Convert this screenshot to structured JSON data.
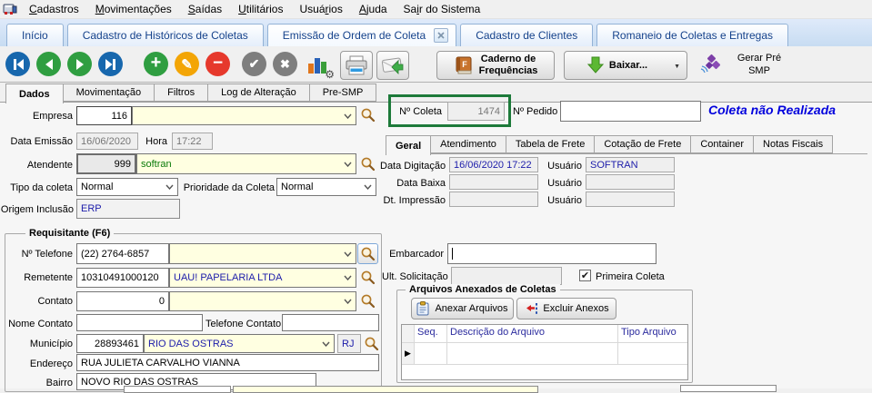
{
  "menubar": {
    "items": [
      {
        "pre": "",
        "key": "C",
        "post": "adastros"
      },
      {
        "pre": "",
        "key": "M",
        "post": "ovimentações"
      },
      {
        "pre": "",
        "key": "S",
        "post": "aídas"
      },
      {
        "pre": "",
        "key": "U",
        "post": "tilitários"
      },
      {
        "pre": "Usuá",
        "key": "r",
        "post": "ios"
      },
      {
        "pre": "",
        "key": "A",
        "post": "juda"
      },
      {
        "pre": "Sa",
        "key": "i",
        "post": "r do Sistema"
      }
    ]
  },
  "tabstrip": {
    "tabs": [
      "Início",
      "Cadastro de Históricos de Coletas",
      "Emissão de Ordem de Coleta",
      "Cadastro de Clientes",
      "Romaneio de Coletas e Entregas"
    ]
  },
  "toolbar": {
    "caderno": {
      "line1": "Caderno de",
      "line2": "Frequências"
    },
    "baixar": {
      "label": "Baixar..."
    },
    "gerar": {
      "line1": "Gerar Pré",
      "line2": "SMP"
    }
  },
  "subtabs": {
    "tabs": [
      "Dados",
      "Movimentação",
      "Filtros",
      "Log de Alteração",
      "Pre-SMP"
    ]
  },
  "header": {
    "coleta_label": "Nº Coleta",
    "coleta_value": "1474",
    "pedido_label": "Nº Pedido",
    "pedido_value": "",
    "status": "Coleta não Realizada"
  },
  "form": {
    "empresa_label": "Empresa",
    "empresa_code": "116",
    "empresa_name": "",
    "data_emissao_label": "Data Emissão",
    "data_emissao": "16/06/2020",
    "hora_label": "Hora",
    "hora": "17:22",
    "atendente_label": "Atendente",
    "atendente_code": "999",
    "atendente_name": "softran",
    "tipo_label": "Tipo da coleta",
    "tipo_value": "Normal",
    "prioridade_label": "Prioridade da Coleta",
    "prioridade_value": "Normal",
    "origem_label": "Origem Inclusão",
    "origem_value": "ERP"
  },
  "geral": {
    "tabs": [
      "Geral",
      "Atendimento",
      "Tabela de Frete",
      "Cotação de Frete",
      "Container",
      "Notas Fiscais"
    ],
    "digitacao_label": "Data Digitação",
    "digitacao_value": "16/06/2020 17:22",
    "usuario_label": "Usuário",
    "usuario1": "SOFTRAN",
    "baixa_label": "Data Baixa",
    "baixa_value": "",
    "usuario2": "",
    "impressao_label": "Dt. Impressão",
    "impressao_value": "",
    "usuario3": ""
  },
  "requisitante": {
    "title": "Requisitante (F6)",
    "telefone_label": "Nº Telefone",
    "telefone": "(22) 2764-6857",
    "telefone_combo": "",
    "remetente_label": "Remetente",
    "remetente_code": "10310491000120",
    "remetente_name": "UAU! PAPELARIA LTDA",
    "contato_label": "Contato",
    "contato_code": "0",
    "contato_name": "",
    "nome_contato_label": "Nome Contato",
    "nome_contato": "",
    "telefone_contato_label": "Telefone Contato",
    "telefone_contato": "",
    "municipio_label": "Município",
    "municipio_code": "28893461",
    "municipio_name": "RIO DAS OSTRAS",
    "municipio_uf": "RJ",
    "endereco_label": "Endereço",
    "endereco": "RUA JULIETA CARVALHO VIANNA",
    "bairro_label": "Bairro",
    "bairro": "NOVO RIO DAS OSTRAS"
  },
  "lado_direito": {
    "embarcador_label": "Embarcador",
    "embarcador": "",
    "ult_solicitacao_label": "Ult. Solicitação",
    "ult_solicitacao": "",
    "primeira_coleta_label": "Primeira Coleta",
    "anexos_title": "Arquivos Anexados de Coletas",
    "anexar_label": "Anexar Arquivos",
    "excluir_label": "Excluir Anexos",
    "grid_columns": [
      "Seq.",
      "Descrição do Arquivo",
      "Tipo Arquivo"
    ]
  }
}
